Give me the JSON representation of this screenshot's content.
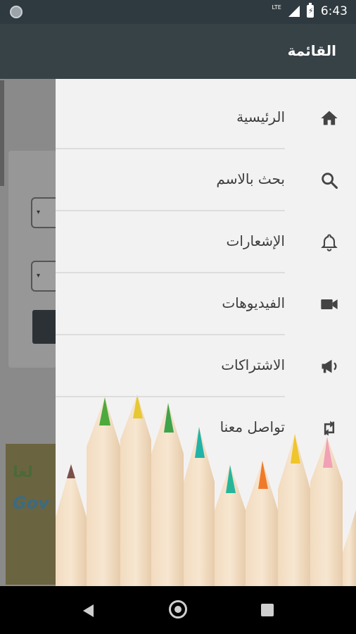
{
  "status_bar": {
    "time": "6:43",
    "network": "LTE"
  },
  "background_app": {
    "select_arrow_1": "▾",
    "select_arrow_2": "▾",
    "banner_top_text": "لغا",
    "banner_text": "Gov"
  },
  "drawer": {
    "title": "القائمة",
    "items": [
      {
        "label": "الرئيسية",
        "icon": "home-icon"
      },
      {
        "label": "بحث بالاسم",
        "icon": "search-icon"
      },
      {
        "label": "الإشعارات",
        "icon": "bell-icon"
      },
      {
        "label": "الفيديوهات",
        "icon": "video-camera-icon"
      },
      {
        "label": "الاشتراكات",
        "icon": "megaphone-icon"
      },
      {
        "label": "تواصل معنا",
        "icon": "swap-arrows-icon"
      }
    ]
  },
  "colors": {
    "header": "#374247",
    "drawer_bg": "#f3f2f3",
    "icon": "#444444"
  }
}
